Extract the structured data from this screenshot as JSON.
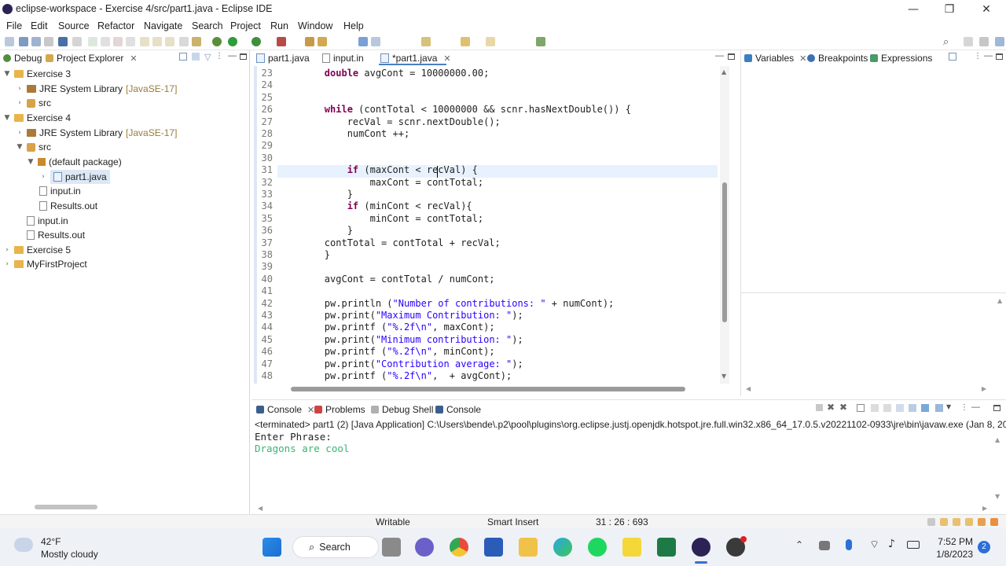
{
  "window": {
    "title": "eclipse-workspace - Exercise 4/src/part1.java - Eclipse IDE"
  },
  "menu": [
    "File",
    "Edit",
    "Source",
    "Refactor",
    "Navigate",
    "Search",
    "Project",
    "Run",
    "Window",
    "Help"
  ],
  "left_tabs": {
    "debug": "Debug",
    "project_explorer": "Project Explorer"
  },
  "tree": {
    "ex3": "Exercise 3",
    "ex3_jre": "JRE System Library",
    "ex3_jre_ver": "[JavaSE-17]",
    "ex3_src": "src",
    "ex4": "Exercise 4",
    "ex4_jre": "JRE System Library",
    "ex4_jre_ver": "[JavaSE-17]",
    "ex4_src": "src",
    "default_pkg": "(default package)",
    "part1": "part1.java",
    "input_in": "input.in",
    "results_out": "Results.out",
    "root_input": "input.in",
    "root_results": "Results.out",
    "ex5": "Exercise 5",
    "myfirst": "MyFirstProject"
  },
  "editor_tabs": [
    "part1.java",
    "input.in",
    "*part1.java"
  ],
  "right_tabs": [
    "Variables",
    "Breakpoints",
    "Expressions"
  ],
  "code_lines": [
    {
      "n": "23",
      "t": "        double avgCont = 10000000.00;"
    },
    {
      "n": "24",
      "t": ""
    },
    {
      "n": "25",
      "t": ""
    },
    {
      "n": "26",
      "t": "        while (contTotal < 10000000 && scnr.hasNextDouble()) {"
    },
    {
      "n": "27",
      "t": "            recVal = scnr.nextDouble();"
    },
    {
      "n": "28",
      "t": "            numCont ++;"
    },
    {
      "n": "29",
      "t": ""
    },
    {
      "n": "30",
      "t": ""
    },
    {
      "n": "31",
      "t": "            if (maxCont < recVal) {"
    },
    {
      "n": "32",
      "t": "                maxCont = contTotal;"
    },
    {
      "n": "33",
      "t": "            }"
    },
    {
      "n": "34",
      "t": "            if (minCont < recVal){"
    },
    {
      "n": "35",
      "t": "                minCont = contTotal;"
    },
    {
      "n": "36",
      "t": "            }"
    },
    {
      "n": "37",
      "t": "        contTotal = contTotal + recVal;"
    },
    {
      "n": "38",
      "t": "        }"
    },
    {
      "n": "39",
      "t": ""
    },
    {
      "n": "40",
      "t": "        avgCont = contTotal / numCont;"
    },
    {
      "n": "41",
      "t": ""
    },
    {
      "n": "42",
      "t": "        pw.println (\"Number of contributions: \" + numCont);"
    },
    {
      "n": "43",
      "t": "        pw.print(\"Maximum Contribution: \");"
    },
    {
      "n": "44",
      "t": "        pw.printf (\"%.2f\\n\", maxCont);"
    },
    {
      "n": "45",
      "t": "        pw.print(\"Minimum contribution: \");"
    },
    {
      "n": "46",
      "t": "        pw.printf (\"%.2f\\n\", minCont);"
    },
    {
      "n": "47",
      "t": "        pw.print(\"Contribution average: \");"
    },
    {
      "n": "48",
      "t": "        pw.printf (\"%.2f\\n\",  + avgCont);"
    }
  ],
  "console_tabs": [
    "Console",
    "Problems",
    "Debug Shell",
    "Console"
  ],
  "console": {
    "header": "<terminated> part1 (2) [Java Application] C:\\Users\\bende\\.p2\\pool\\plugins\\org.eclipse.justj.openjdk.hotspot.jre.full.win32.x86_64_17.0.5.v20221102-0933\\jre\\bin\\javaw.exe  (Jan 8, 20",
    "line1": "Enter Phrase:",
    "line2": "Dragons are cool"
  },
  "status": {
    "writable": "Writable",
    "insert": "Smart Insert",
    "position": "31 : 26 : 693"
  },
  "taskbar": {
    "temp": "42°F",
    "weather": "Mostly cloudy",
    "search": "Search",
    "time": "7:52 PM",
    "date": "1/8/2023",
    "notif": "2"
  },
  "colors": {
    "accent": "#2a00ff",
    "keyword": "#7f0055",
    "console_input": "#3cb371"
  }
}
